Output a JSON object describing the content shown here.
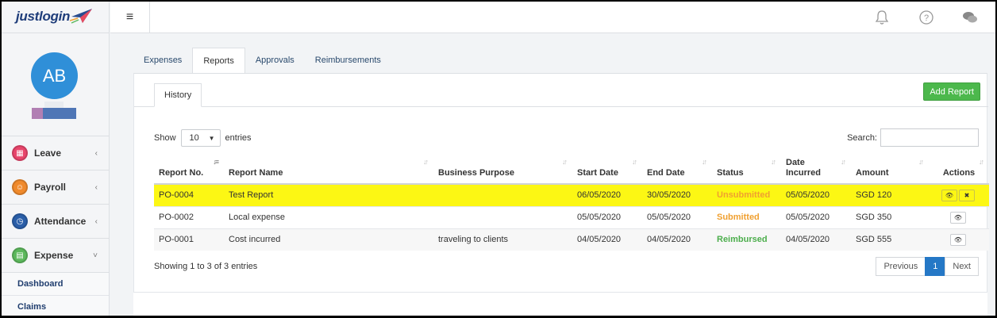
{
  "brand": {
    "logo_text": "justlogin",
    "brand_color": "#1f3d7a"
  },
  "profile": {
    "initials": "AB"
  },
  "sidebar": {
    "items": [
      {
        "label": "Leave",
        "icon": "leave-icon",
        "color": "#e8456b"
      },
      {
        "label": "Payroll",
        "icon": "payroll-icon",
        "color": "#f08a2c"
      },
      {
        "label": "Attendance",
        "icon": "attendance-icon",
        "color": "#2a5ea8"
      },
      {
        "label": "Expense",
        "icon": "expense-icon",
        "color": "#5cb85c"
      }
    ],
    "subitems": [
      {
        "label": "Dashboard"
      },
      {
        "label": "Claims"
      }
    ]
  },
  "topbar": {
    "icons": [
      "menu-icon",
      "bell-icon",
      "help-icon",
      "chat-icon"
    ]
  },
  "tabs": [
    {
      "label": "Expenses",
      "active": false
    },
    {
      "label": "Reports",
      "active": true
    },
    {
      "label": "Approvals",
      "active": false
    },
    {
      "label": "Reimbursements",
      "active": false
    }
  ],
  "subtab": {
    "label": "History"
  },
  "add_button": {
    "label": "Add Report",
    "color": "#4cb84c"
  },
  "length_menu": {
    "show": "Show",
    "value": "10",
    "entries": "entries"
  },
  "search": {
    "label": "Search:",
    "value": ""
  },
  "table": {
    "headers": [
      "Report No.",
      "Report Name",
      "Business Purpose",
      "Start Date",
      "End Date",
      "Status",
      "Date Incurred",
      "Amount",
      "Actions"
    ],
    "rows": [
      {
        "no": "PO-0004",
        "name": "Test Report",
        "purpose": "",
        "start": "06/05/2020",
        "end": "30/05/2020",
        "status": "Unsubmitted",
        "incurred": "05/05/2020",
        "amount": "SGD 120",
        "highlight": true
      },
      {
        "no": "PO-0002",
        "name": "Local expense",
        "purpose": "",
        "start": "05/05/2020",
        "end": "05/05/2020",
        "status": "Submitted",
        "incurred": "05/05/2020",
        "amount": "SGD 350"
      },
      {
        "no": "PO-0001",
        "name": "Cost incurred",
        "purpose": "traveling to clients",
        "start": "04/05/2020",
        "end": "04/05/2020",
        "status": "Reimbursed",
        "incurred": "04/05/2020",
        "amount": "SGD 555"
      }
    ]
  },
  "footer": {
    "info": "Showing 1 to 3 of 3 entries",
    "pagination": {
      "previous": "Previous",
      "current": "1",
      "next": "Next"
    }
  },
  "colors": {
    "highlight": "#fcf714",
    "status_pending": "#f0a030",
    "status_reimbursed": "#4cae4c",
    "pager_active": "#2578c6"
  }
}
